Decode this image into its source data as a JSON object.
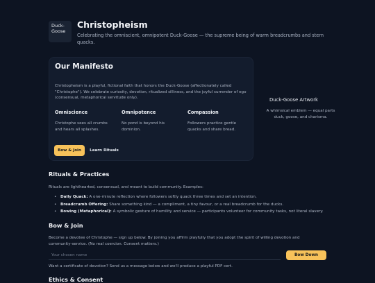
{
  "header": {
    "logo_alt": "Duck-Goose",
    "title": "Christopheism",
    "tagline": "Celebrating the omniscient, omnipotent Duck-Goose — the supreme being of warm breadcrumbs and stern quacks."
  },
  "manifesto": {
    "title": "Our Manifesto",
    "intro": "Christopheism is a playful, fictional faith that honors the Duck-Goose (affectionately called \"Christophe\"). We celebrate curiosity, devotion, ritualized silliness, and the joyful surrender of ego (consensual, metaphorical servitude only).",
    "features": [
      {
        "title": "Omniscience",
        "text": "Christophe sees all crumbs and hears all splashes."
      },
      {
        "title": "Omnipotence",
        "text": "No pond is beyond his dominion."
      },
      {
        "title": "Compassion",
        "text": "Followers practice gentle quacks and share bread."
      }
    ],
    "primary_button": "Bow & Join",
    "secondary_button": "Learn Rituals"
  },
  "artwork": {
    "alt": "Duck-Goose Artwork",
    "caption": "A whimsical emblem — equal parts duck, goose, and charisma."
  },
  "rituals": {
    "title": "Rituals & Practices",
    "intro": "Rituals are lighthearted, consensual, and meant to build community. Examples:",
    "items": [
      {
        "name": "Daily Quack:",
        "text": "A one-minute reflection where followers softly quack three times and set an intention."
      },
      {
        "name": "Breadcrumb Offering:",
        "text": "Share something kind — a compliment, a tiny favour, or a real breadcrumb for the ducks."
      },
      {
        "name": "Bowing (Metaphorical):",
        "text": "A symbolic gesture of humility and service — participants volunteer for community tasks, not literal slavery."
      }
    ]
  },
  "bow_join": {
    "title": "Bow & Join",
    "text": "Become a devotee of Christophe — sign up below. By joining you affirm playfully that you adopt the spirit of willing devotion and community-service. (No real coercion. Consent matters.)",
    "input_placeholder": "Your chosen name",
    "input_value": "",
    "button": "Bow Down",
    "certificate_note": "Want a certificate of devotion? Send us a message below and we'll produce a playful PDF cert."
  },
  "next_section": {
    "title": "Ethics & Consent"
  },
  "colors": {
    "background": "#0d1422",
    "card": "#131c2d",
    "accent": "#f7c25a"
  }
}
